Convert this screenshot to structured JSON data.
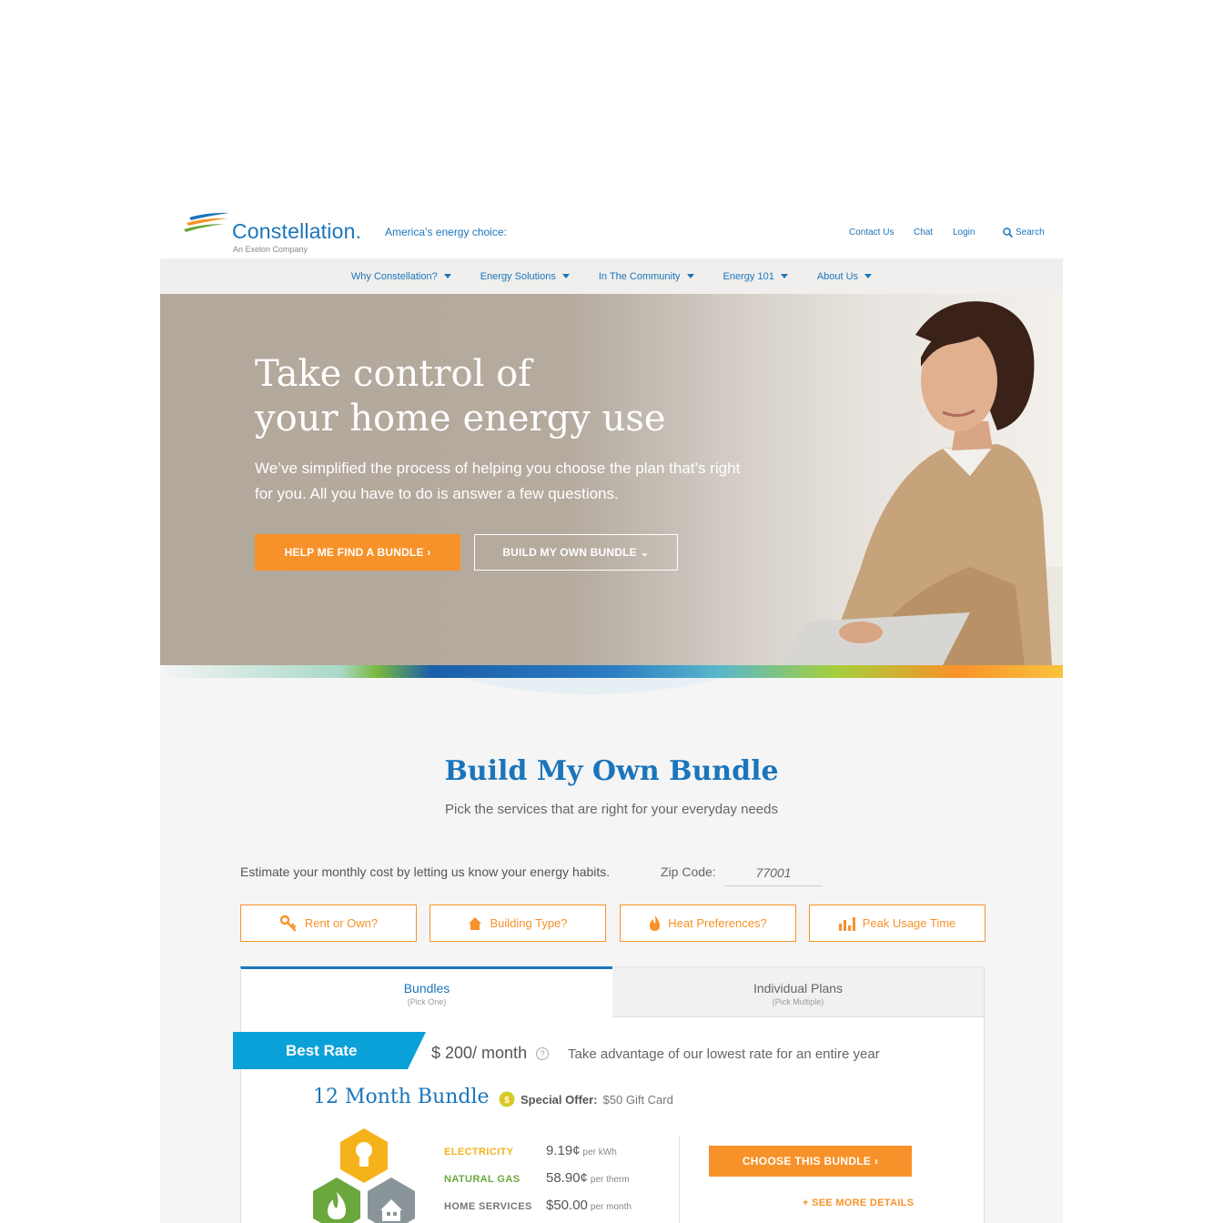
{
  "header": {
    "logo_name": "Constellation.",
    "logo_sub": "An Exelon Company",
    "tagline": "America’s energy choice:",
    "links": [
      "Contact Us",
      "Chat",
      "Login"
    ],
    "search_label": "Search"
  },
  "nav": {
    "items": [
      "Why Constellation?",
      "Energy Solutions",
      "In The Community",
      "Energy 101",
      "About Us"
    ]
  },
  "hero": {
    "title_line1": "Take control of",
    "title_line2": "your home energy use",
    "body": "We’ve simplified the process of helping you choose the plan that’s right for you. All you have to do is answer a few questions.",
    "primary_button": "HELP ME FIND A BUNDLE  ›",
    "secondary_button": "BUILD MY OWN BUNDLE  ⌄"
  },
  "bundle_section": {
    "title": "Build My Own Bundle",
    "subtitle": "Pick the services that are right for your everyday needs",
    "estimate_text": "Estimate your monthly cost by letting us know your energy habits.",
    "zip_label": "Zip Code:",
    "zip_value": "77001",
    "questions": [
      "Rent or Own?",
      "Building Type?",
      "Heat Preferences?",
      "Peak Usage Time"
    ]
  },
  "tabs": [
    {
      "label": "Bundles",
      "note": "(Pick One)"
    },
    {
      "label": "Individual Plans",
      "note": "(Pick Multiple)"
    }
  ],
  "offer_card": {
    "ribbon": "Best Rate",
    "price": "$ 200/ month",
    "price_note": "Take advantage of our lowest rate for an entire year",
    "bundle_name": "12 Month Bundle",
    "special_offer_label": "Special Offer:",
    "special_offer_value": "$50 Gift Card",
    "rates": [
      {
        "label": "ELECTRICITY",
        "value": "9.19¢",
        "unit": "per kWh",
        "color": "#f5b21b"
      },
      {
        "label": "NATURAL GAS",
        "value": "58.90¢",
        "unit": "per therm",
        "color": "#6aa83e"
      },
      {
        "label": "HOME SERVICES",
        "value": "$50.00",
        "unit": "per month",
        "color": "#777777"
      }
    ],
    "choose_button": "CHOOSE THIS BUNDLE  ›",
    "more_link": "+  SEE MORE DETAILS"
  },
  "colors": {
    "brand_blue": "#1b75bb",
    "accent_orange": "#f7922a",
    "ribbon_blue": "#0aa0d8"
  }
}
